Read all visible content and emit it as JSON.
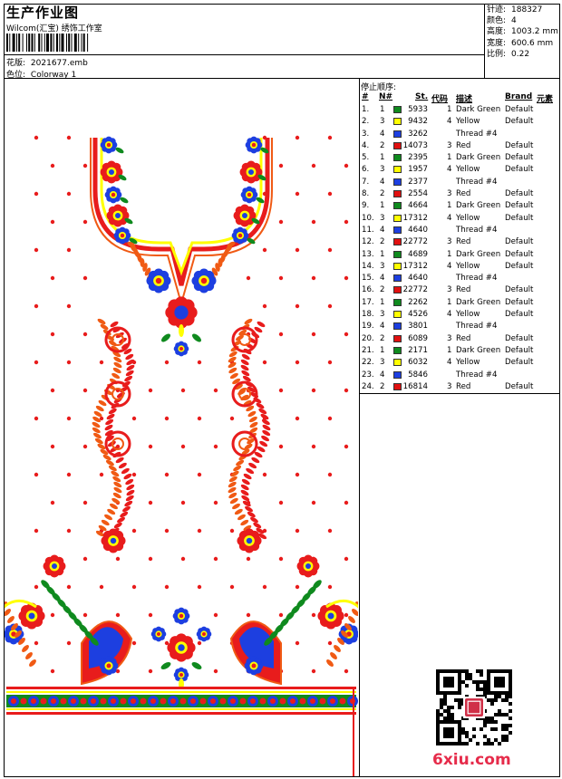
{
  "header": {
    "title": "生产作业图",
    "company": "Wilcom(汇宝) 绣饰工作室",
    "design_label": "花版:",
    "design_value": "2021677.emb",
    "colorway_label": "色位:",
    "colorway_value": "Colorway 1"
  },
  "specs": [
    {
      "label": "针迹:",
      "value": "188327"
    },
    {
      "label": "颜色:",
      "value": "4"
    },
    {
      "label": "高度:",
      "value": "1003.2 mm"
    },
    {
      "label": "宽度:",
      "value": "600.6 mm"
    },
    {
      "label": "比例:",
      "value": "0.22"
    }
  ],
  "stop_sequence": {
    "title": "停止顺序:",
    "columns": {
      "hash": "#",
      "n": "N#",
      "st": "St.",
      "code": "代码",
      "desc": "描述",
      "brand": "Brand",
      "elem": "元素"
    },
    "rows": [
      {
        "idx": "1.",
        "n": "1",
        "color": "#0f8a1e",
        "st": "5933",
        "code": "1",
        "desc": "Dark Green",
        "brand": "Default"
      },
      {
        "idx": "2.",
        "n": "3",
        "color": "#ffff00",
        "st": "9432",
        "code": "4",
        "desc": "Yellow",
        "brand": "Default"
      },
      {
        "idx": "3.",
        "n": "4",
        "color": "#1d3fe0",
        "st": "3262",
        "code": "",
        "desc": "Thread #4",
        "brand": ""
      },
      {
        "idx": "4.",
        "n": "2",
        "color": "#e01010",
        "st": "14073",
        "code": "3",
        "desc": "Red",
        "brand": "Default"
      },
      {
        "idx": "5.",
        "n": "1",
        "color": "#0f8a1e",
        "st": "2395",
        "code": "1",
        "desc": "Dark Green",
        "brand": "Default"
      },
      {
        "idx": "6.",
        "n": "3",
        "color": "#ffff00",
        "st": "1957",
        "code": "4",
        "desc": "Yellow",
        "brand": "Default"
      },
      {
        "idx": "7.",
        "n": "4",
        "color": "#1d3fe0",
        "st": "2377",
        "code": "",
        "desc": "Thread #4",
        "brand": ""
      },
      {
        "idx": "8.",
        "n": "2",
        "color": "#e01010",
        "st": "2554",
        "code": "3",
        "desc": "Red",
        "brand": "Default"
      },
      {
        "idx": "9.",
        "n": "1",
        "color": "#0f8a1e",
        "st": "4664",
        "code": "1",
        "desc": "Dark Green",
        "brand": "Default"
      },
      {
        "idx": "10.",
        "n": "3",
        "color": "#ffff00",
        "st": "17312",
        "code": "4",
        "desc": "Yellow",
        "brand": "Default"
      },
      {
        "idx": "11.",
        "n": "4",
        "color": "#1d3fe0",
        "st": "4640",
        "code": "",
        "desc": "Thread #4",
        "brand": ""
      },
      {
        "idx": "12.",
        "n": "2",
        "color": "#e01010",
        "st": "22772",
        "code": "3",
        "desc": "Red",
        "brand": "Default"
      },
      {
        "idx": "13.",
        "n": "1",
        "color": "#0f8a1e",
        "st": "4689",
        "code": "1",
        "desc": "Dark Green",
        "brand": "Default"
      },
      {
        "idx": "14.",
        "n": "3",
        "color": "#ffff00",
        "st": "17312",
        "code": "4",
        "desc": "Yellow",
        "brand": "Default"
      },
      {
        "idx": "15.",
        "n": "4",
        "color": "#1d3fe0",
        "st": "4640",
        "code": "",
        "desc": "Thread #4",
        "brand": ""
      },
      {
        "idx": "16.",
        "n": "2",
        "color": "#e01010",
        "st": "22772",
        "code": "3",
        "desc": "Red",
        "brand": "Default"
      },
      {
        "idx": "17.",
        "n": "1",
        "color": "#0f8a1e",
        "st": "2262",
        "code": "1",
        "desc": "Dark Green",
        "brand": "Default"
      },
      {
        "idx": "18.",
        "n": "3",
        "color": "#ffff00",
        "st": "4526",
        "code": "4",
        "desc": "Yellow",
        "brand": "Default"
      },
      {
        "idx": "19.",
        "n": "4",
        "color": "#1d3fe0",
        "st": "3801",
        "code": "",
        "desc": "Thread #4",
        "brand": ""
      },
      {
        "idx": "20.",
        "n": "2",
        "color": "#e01010",
        "st": "6089",
        "code": "3",
        "desc": "Red",
        "brand": "Default"
      },
      {
        "idx": "21.",
        "n": "1",
        "color": "#0f8a1e",
        "st": "2171",
        "code": "1",
        "desc": "Dark Green",
        "brand": "Default"
      },
      {
        "idx": "22.",
        "n": "3",
        "color": "#ffff00",
        "st": "6032",
        "code": "4",
        "desc": "Yellow",
        "brand": "Default"
      },
      {
        "idx": "23.",
        "n": "4",
        "color": "#1d3fe0",
        "st": "5846",
        "code": "",
        "desc": "Thread #4",
        "brand": ""
      },
      {
        "idx": "24.",
        "n": "2",
        "color": "#e01010",
        "st": "16814",
        "code": "3",
        "desc": "Red",
        "brand": "Default"
      }
    ]
  },
  "palette": {
    "red": "#e81c1c",
    "orange": "#f05a14",
    "blue": "#1d3fe0",
    "green": "#0f8a1e",
    "yellow": "#ffff00"
  },
  "watermark": {
    "text": "6xiu.com",
    "color": "#e62b4a"
  }
}
